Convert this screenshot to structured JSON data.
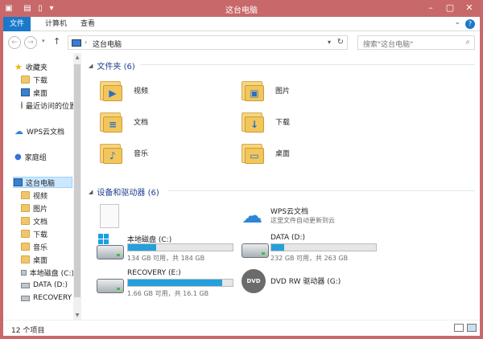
{
  "window": {
    "title": "这台电脑",
    "frame_color": "#c8686a",
    "accent": "#1979ca"
  },
  "ribbon": {
    "tabs": [
      "文件",
      "计算机",
      "查看"
    ],
    "help": "?",
    "collapse": "⌄"
  },
  "address": {
    "path": "这台电脑",
    "separator": "›",
    "search_placeholder": "搜索\"这台电脑\""
  },
  "nav": {
    "favorites_label": "收藏夹",
    "favorites": [
      "下载",
      "桌面",
      "最近访问的位置"
    ],
    "wps": "WPS云文档",
    "homegroup": "家庭组",
    "thispc": "这台电脑",
    "thispc_items": [
      "视频",
      "图片",
      "文档",
      "下载",
      "音乐",
      "桌面",
      "本地磁盘 (C:)",
      "DATA (D:)",
      "RECOVERY"
    ]
  },
  "folders": {
    "header": "文件夹 (6)",
    "items": [
      {
        "name": "视频",
        "icon": "video-icon",
        "glyph": "▶"
      },
      {
        "name": "图片",
        "icon": "picture-icon",
        "glyph": "▣"
      },
      {
        "name": "文档",
        "icon": "document-icon",
        "glyph": "≡"
      },
      {
        "name": "下载",
        "icon": "download-icon",
        "glyph": "↓"
      },
      {
        "name": "音乐",
        "icon": "music-icon",
        "glyph": "♪"
      },
      {
        "name": "桌面",
        "icon": "desktop-icon",
        "glyph": "▭"
      }
    ]
  },
  "devices": {
    "header": "设备和驱动器 (6)",
    "wps": {
      "name": "WPS云文档",
      "sub": "这里文件自动更新到云"
    },
    "drives": [
      {
        "name": "本地磁盘 (C:)",
        "sub": "134 GB 可用，共 184 GB",
        "used_fraction": 0.27
      },
      {
        "name": "DATA (D:)",
        "sub": "232 GB 可用，共 263 GB",
        "used_fraction": 0.12
      },
      {
        "name": "RECOVERY (E:)",
        "sub": "1.66 GB 可用，共 16.1 GB",
        "used_fraction": 0.9
      },
      {
        "name": "DVD RW 驱动器 (G:)",
        "badge": "DVD"
      }
    ]
  },
  "status": {
    "count": "12 个项目"
  }
}
